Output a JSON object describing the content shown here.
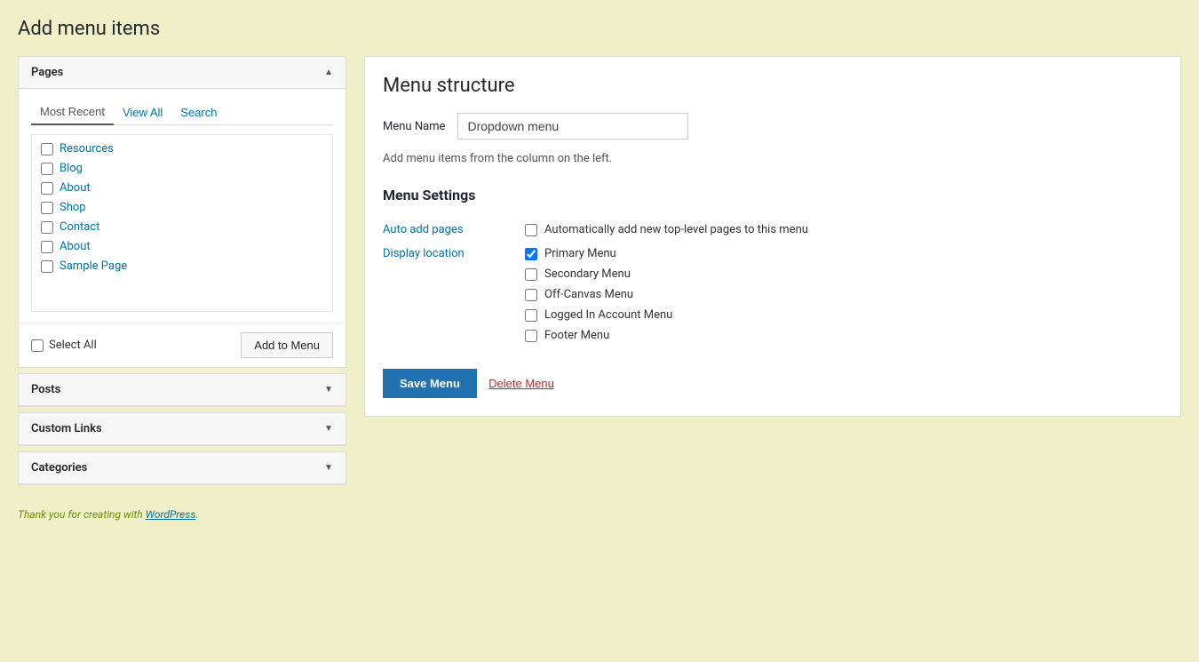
{
  "page": {
    "title": "Add menu items"
  },
  "left_column": {
    "sections": [
      {
        "id": "pages",
        "label": "Pages",
        "open": true,
        "tabs": [
          "Most Recent",
          "View All",
          "Search"
        ],
        "active_tab": "Most Recent",
        "items": [
          "Resources",
          "Blog",
          "About",
          "Shop",
          "Contact",
          "About",
          "Sample Page"
        ],
        "select_all_label": "Select All",
        "add_button_label": "Add to Menu"
      },
      {
        "id": "posts",
        "label": "Posts",
        "open": false
      },
      {
        "id": "custom-links",
        "label": "Custom Links",
        "open": false
      },
      {
        "id": "categories",
        "label": "Categories",
        "open": false
      }
    ]
  },
  "right_column": {
    "title": "Menu structure",
    "menu_name_label": "Menu Name",
    "menu_name_value": "Dropdown menu",
    "hint_text": "Add menu items from the column on the left.",
    "settings": {
      "title": "Menu Settings",
      "auto_add_pages": {
        "label": "Auto add pages",
        "option_label": "Automatically add new top-level pages to this menu",
        "checked": false
      },
      "display_location": {
        "label": "Display location",
        "options": [
          {
            "label": "Primary Menu",
            "checked": true
          },
          {
            "label": "Secondary Menu",
            "checked": false
          },
          {
            "label": "Off-Canvas Menu",
            "checked": false
          },
          {
            "label": "Logged In Account Menu",
            "checked": false
          },
          {
            "label": "Footer Menu",
            "checked": false
          }
        ]
      }
    },
    "save_button_label": "Save Menu",
    "delete_button_label": "Delete Menu"
  },
  "footer": {
    "text_before_link": "Thank you for creating with ",
    "link_text": "WordPress",
    "text_after_link": "."
  }
}
